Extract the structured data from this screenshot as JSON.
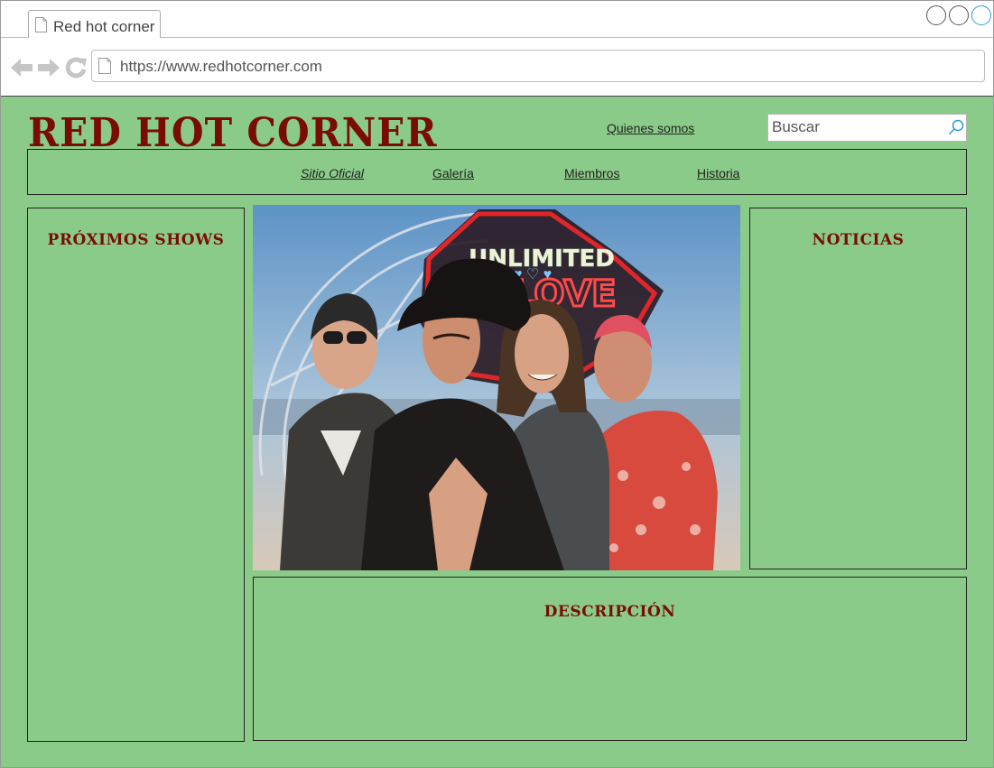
{
  "browser": {
    "tab_title": "Red hot corner",
    "url": "https://www.redhotcorner.com"
  },
  "site": {
    "logo": "RED HOT CORNER",
    "about_link": "Quienes somos",
    "search": {
      "placeholder": "Buscar"
    },
    "nav": [
      {
        "label": "Sitio Oficial"
      },
      {
        "label": "Galería"
      },
      {
        "label": "Miembros"
      },
      {
        "label": "Historia"
      }
    ],
    "sections": {
      "upcoming_shows": "PRÓXIMOS SHOWS",
      "news": "NOTICIAS",
      "description": "DESCRIPCIÓN"
    }
  },
  "photo": {
    "neon_sign": "UNLIMITED LOVE"
  },
  "colors": {
    "page_background": "#8bcb89",
    "brand_red": "#7a0c08",
    "search_icon": "#2a9bd6"
  }
}
